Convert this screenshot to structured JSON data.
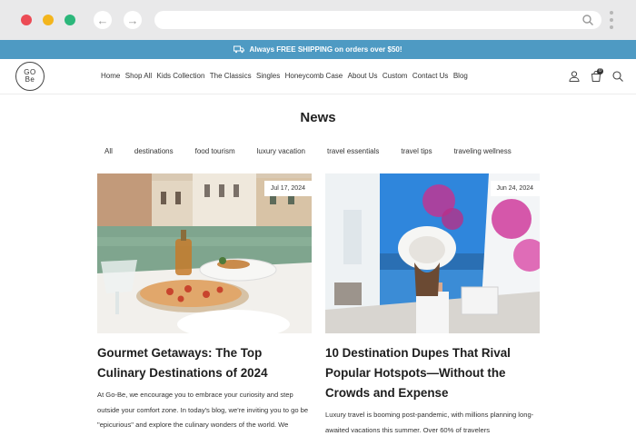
{
  "announcement": {
    "text": "Always FREE SHIPPING on orders over $50!",
    "icon": "truck-icon"
  },
  "logo": {
    "line1": "GO",
    "line2": "Be"
  },
  "nav": {
    "items": [
      "Home",
      "Shop All",
      "Kids Collection",
      "The Classics",
      "Singles",
      "Honeycomb Case",
      "About Us",
      "Custom",
      "Contact Us",
      "Blog"
    ],
    "cart_count": "0"
  },
  "page": {
    "title": "News"
  },
  "filters": [
    "All",
    "destinations",
    "food tourism",
    "luxury vacation",
    "travel essentials",
    "travel tips",
    "traveling wellness"
  ],
  "articles": [
    {
      "date": "Jul 17, 2024",
      "title": "Gourmet Getaways: The Top Culinary Destinations of 2024",
      "excerpt": "At Go-Be, we encourage you to embrace your curiosity and step outside your comfort zone. In today's blog, we're inviting you to go be \"epicurious\" and explore the culinary wonders of the world. We believe some of life's greatest adventures start",
      "image": "pizza-canal-photo"
    },
    {
      "date": "Jun 24, 2024",
      "title": "10 Destination Dupes That Rival Popular Hotspots—Without the Crowds and Expense",
      "excerpt": "Luxury travel is booming post-pandemic, with millions planning long-awaited vacations this summer. Over 60% of travelers",
      "image": "woman-sun-hat-photo"
    }
  ],
  "colors": {
    "announcement_bg": "#4e9ac3",
    "chrome_bg": "#e9e9ea"
  }
}
